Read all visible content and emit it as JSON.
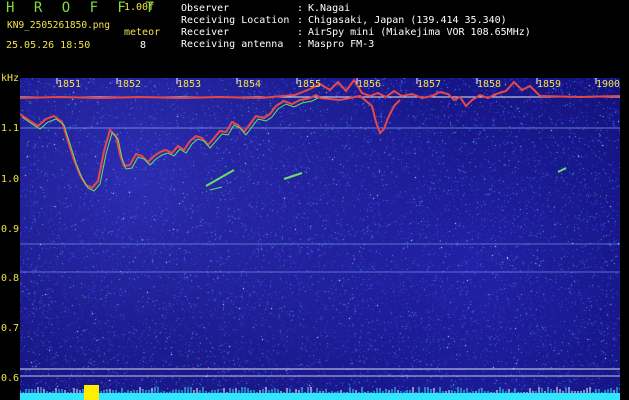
{
  "header": {
    "brand": "H R O F F T",
    "version": "1.00f",
    "filename": "KN9_2505261850.png",
    "meteor_label": "meteor",
    "timestamp": "25.05.26 18:50",
    "meteor_count": "8"
  },
  "info": [
    {
      "label": "Observer",
      "value": "K.Nagai"
    },
    {
      "label": "Receiving Location",
      "value": "Chigasaki, Japan (139.414 35.340)"
    },
    {
      "label": "Receiver",
      "value": "AirSpy mini (Miakejima VOR 108.65MHz)"
    },
    {
      "label": "Receiving antenna",
      "value": "Maspro FM-3"
    }
  ],
  "plot": {
    "y_unit": "kHz",
    "y_ticks": [
      "1.1",
      "1.0",
      "0.9",
      "0.8",
      "0.7",
      "0.6"
    ],
    "x_ticks": [
      "1851",
      "1852",
      "1853",
      "1854",
      "1855",
      "1856",
      "1857",
      "1858",
      "1859",
      "1900"
    ]
  },
  "colors": {
    "background": "#000000",
    "header_green": "#7fdc3c",
    "label_yellow": "#f2e34a",
    "plot_blue": "#0e0e72",
    "trace_red": "#e64848",
    "trace_green": "#66e066",
    "baseline_cyan": "#33e6ff",
    "burst_yellow": "#ffee00"
  }
}
